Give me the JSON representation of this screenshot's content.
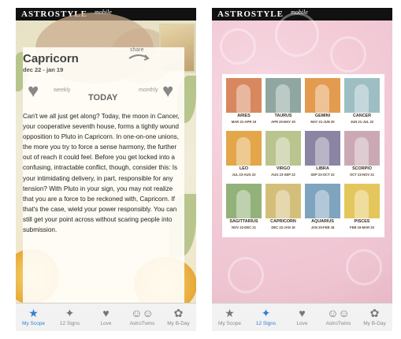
{
  "app": {
    "brand": "ASTROSTYLE",
    "brand_sub": "mobile"
  },
  "scope": {
    "title": "Capricorn",
    "dates": "dec 22 - jan 19",
    "share": "share",
    "weekly": "weekly",
    "monthly": "monthly",
    "today": "TODAY",
    "horoscope": "Can't we all just get along? Today, the moon in Cancer, your cooperative seventh house, forms a tightly wound opposition to Pluto in Capricorn. In one-on-one unions, the more you try to force a sense harmony, the further out of reach it could feel. Before you get locked into a confusing, intractable conflict, though, consider this: Is your intimidating delivery, in part, responsible for any tension? With Pluto in your sign, you may not realize that you are a force to be reckoned with, Capricorn. If that's the case, wield your power responsibly. You can still get your point across without scaring people into submission."
  },
  "tabs_left": [
    {
      "label": "My Scope",
      "icon": "star-icon",
      "active": true
    },
    {
      "label": "12 Signs",
      "icon": "comet-icon",
      "active": false
    },
    {
      "label": "Love",
      "icon": "heart-icon",
      "active": false
    },
    {
      "label": "AstroTwins",
      "icon": "twins-icon",
      "active": false
    },
    {
      "label": "My B-Day",
      "icon": "flower-icon",
      "active": false
    }
  ],
  "tabs_right": [
    {
      "label": "My Scope",
      "icon": "star-icon",
      "active": false
    },
    {
      "label": "12 Signs",
      "icon": "comet-icon",
      "active": true
    },
    {
      "label": "Love",
      "icon": "heart-icon",
      "active": false
    },
    {
      "label": "AstroTwins",
      "icon": "twins-icon",
      "active": false
    },
    {
      "label": "My B-Day",
      "icon": "flower-icon",
      "active": false
    }
  ],
  "signs": [
    {
      "name": "ARIES",
      "dates": "MAR 21-APR 19",
      "color": "#d9875f"
    },
    {
      "name": "TAURUS",
      "dates": "APR 20-MAY 20",
      "color": "#8fa7a0"
    },
    {
      "name": "GEMINI",
      "dates": "MAY 21-JUN 20",
      "color": "#e39b4f"
    },
    {
      "name": "CANCER",
      "dates": "JUN 21-JUL 22",
      "color": "#9dbfc4"
    },
    {
      "name": "LEO",
      "dates": "JUL 23-AUG 22",
      "color": "#e3a64a"
    },
    {
      "name": "VIRGO",
      "dates": "AUG 23-SEP 22",
      "color": "#b9c48e"
    },
    {
      "name": "LIBRA",
      "dates": "SEP 23-OCT 22",
      "color": "#8b84a2"
    },
    {
      "name": "SCORPIO",
      "dates": "OCT 23-NOV 21",
      "color": "#caa9b5"
    },
    {
      "name": "SAGITTARIUS",
      "dates": "NOV 22-DEC 21",
      "color": "#93b279"
    },
    {
      "name": "CAPRICORN",
      "dates": "DEC 22-JAN 19",
      "color": "#d4bf7a"
    },
    {
      "name": "AQUARIUS",
      "dates": "JAN 20-FEB 18",
      "color": "#7fa4bf"
    },
    {
      "name": "PISCES",
      "dates": "FEB 19-MAR 20",
      "color": "#e4c75c"
    }
  ]
}
